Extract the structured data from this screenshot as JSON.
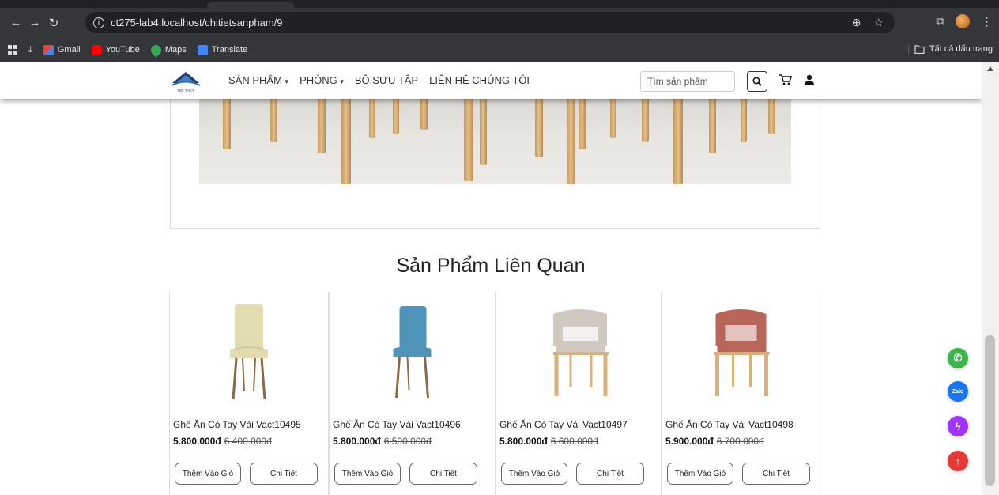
{
  "browser": {
    "url": "ct275-lab4.localhost/chitietsanpham/9",
    "bookmarks": [
      "Gmail",
      "YouTube",
      "Maps",
      "Translate"
    ],
    "all_bookmarks_label": "Tất cả dấu trang"
  },
  "nav": {
    "logo_text": "NỘI THẤT",
    "menu": [
      "SẢN PHẨM",
      "PHÒNG",
      "BỘ SƯU TẬP",
      "LIÊN HỆ CHÚNG TÔI"
    ],
    "search_placeholder": "Tìm sản phẩm"
  },
  "related": {
    "title": "Sản Phẩm Liên Quan",
    "add_to_cart_label": "Thêm Vào Giỏ",
    "detail_label": "Chi Tiết",
    "products": [
      {
        "name": "Ghế Ăn Có Tay Vải Vact10495",
        "price": "5.800.000đ",
        "old_price": "6.400.000đ",
        "color": "#e3dcae"
      },
      {
        "name": "Ghế Ăn Có Tay Vải Vact10496",
        "price": "5.800.000đ",
        "old_price": "6.500.000đ",
        "color": "#4f93b8"
      },
      {
        "name": "Ghế Ăn Có Tay Vải Vact10497",
        "price": "5.800.000đ",
        "old_price": "6.600.000đ",
        "color": "#cfc9c1"
      },
      {
        "name": "Ghế Ăn Có Tay Vải Vact10498",
        "price": "5.900.000đ",
        "old_price": "6.700.000đ",
        "color": "#b8665a"
      }
    ]
  },
  "floating": [
    {
      "name": "phone-icon",
      "color": "#3ab54a"
    },
    {
      "name": "zalo-icon",
      "color": "#1877f2",
      "text": "Zalo"
    },
    {
      "name": "messenger-icon",
      "color": "#a033ff"
    },
    {
      "name": "scroll-top-icon",
      "color": "#e53935"
    }
  ]
}
